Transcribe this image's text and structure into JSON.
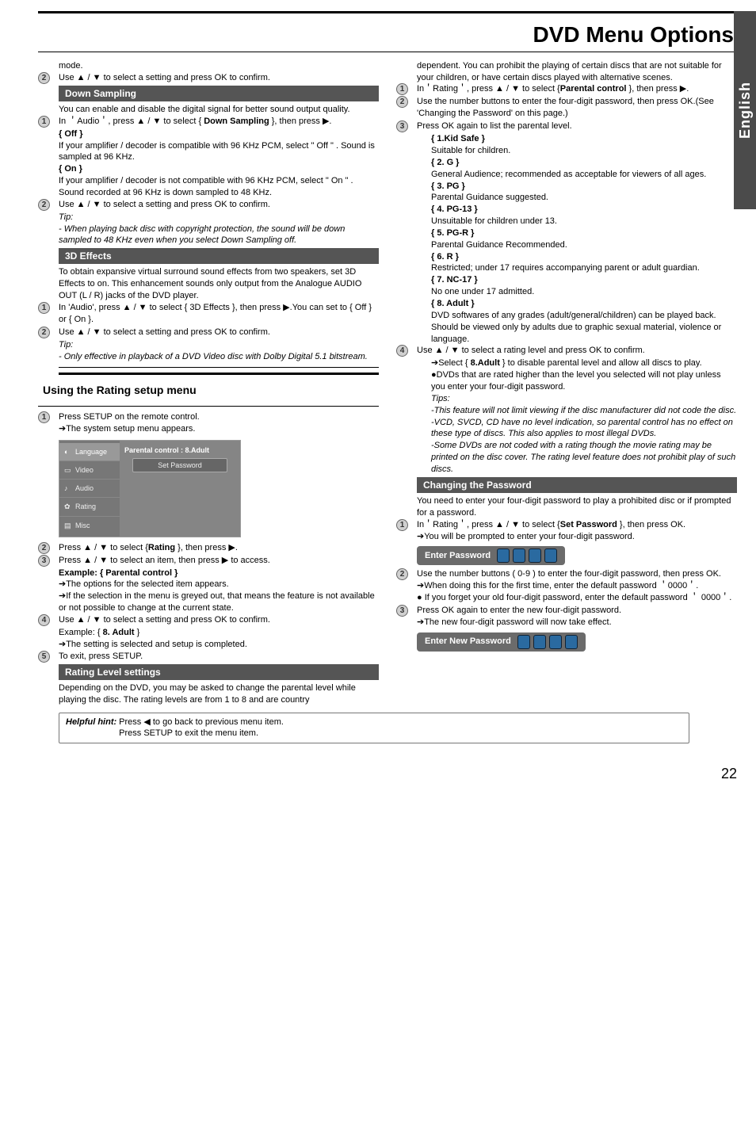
{
  "title": "DVD Menu Options",
  "side_tab": "English",
  "page_number": "22",
  "left": {
    "mode_tail": "mode.",
    "step_mode2": "Use ▲ / ▼ to select a setting and press OK to confirm.",
    "down_sampling": {
      "head": "Down Sampling",
      "intro": "You can enable and disable the digital signal for better sound output quality.",
      "s1": "In ＇Audio＇, press ▲ / ▼ to select { Down Sampling }, then press ▶.",
      "off_label": "{ Off }",
      "off_text": "If your amplifier / decoder is compatible with 96 KHz PCM, select \" Off \" . Sound is sampled at 96 KHz.",
      "on_label": "{ On }",
      "on_text": "If your amplifier / decoder is not compatible with 96 KHz PCM, select \" On \" . Sound recorded at 96 KHz is down sampled to 48 KHz.",
      "s2": "Use ▲ / ▼ to select a setting and press OK to confirm.",
      "tip_label": "Tip:",
      "tip_text": "- When playing back disc with copyright protection, the sound will be down sampled to 48 KHz even when you select Down Sampling off."
    },
    "fx": {
      "head": "3D Effects",
      "intro": "To obtain expansive virtual surround sound effects from two speakers, set 3D Effects to on. This enhancement sounds only output from the Analogue AUDIO OUT (L / R) jacks of the DVD player.",
      "s1": "In 'Audio', press ▲ / ▼ to select { 3D Effects }, then press ▶.You can set to { Off } or { On }.",
      "s2": "Use ▲ / ▼ to select a setting and press OK to confirm.",
      "tip_label": "Tip:",
      "tip_text": "- Only effective in playback of a DVD Video disc with Dolby Digital 5.1 bitstream."
    },
    "rating_setup": {
      "heading": "Using the Rating setup menu",
      "s1a": "Press SETUP on the remote control.",
      "s1b": "➔The system setup menu appears.",
      "menu": {
        "tabs": [
          "Language",
          "Video",
          "Audio",
          "Rating",
          "Misc"
        ],
        "row1": "Parental control      : 8.Adult",
        "btn": "Set Password"
      },
      "s2": "Press ▲ / ▼ to select {Rating }, then press ▶.",
      "s3": "Press ▲ / ▼ to select an item, then press ▶ to access.",
      "ex_label": "Example: { Parental control }",
      "ex_a": "➔The options for the selected item appears.",
      "ex_b": "➔If the selection in the menu is greyed out, that means the feature is not available or not possible to change at the current state.",
      "s4": "Use ▲ / ▼ to select a setting and press OK to confirm.",
      "ex2": "Example: { 8. Adult }",
      "ex2a": "➔The setting is selected and setup is completed.",
      "s5": "To exit, press SETUP.",
      "rls_head": "Rating Level settings",
      "rls_text": "Depending on the DVD, you may be asked to change the parental level while playing the disc. The rating levels are from 1 to 8 and are country"
    }
  },
  "right": {
    "cont": "dependent. You can prohibit the playing of certain discs that are not suitable for your children, or have certain discs played with alternative scenes.",
    "s1": "In＇Rating＇, press ▲ / ▼ to select {Parental control }, then press ▶.",
    "s2": "Use the number buttons to enter the four-digit password, then press OK.(See 'Changing the Password' on this page.)",
    "s3": "Press OK again to list the parental level.",
    "levels": {
      "l1h": "{ 1.Kid Safe }",
      "l1t": "Suitable for children.",
      "l2h": "{ 2. G }",
      "l2t": "General Audience; recommended as acceptable for viewers of all ages.",
      "l3h": "{ 3. PG }",
      "l3t": "Parental Guidance suggested.",
      "l4h": "{ 4. PG-13 }",
      "l4t": "Unsuitable for children under 13.",
      "l5h": "{ 5. PG-R }",
      "l5t": "Parental Guidance Recommended.",
      "l6h": "{ 6. R }",
      "l6t": "Restricted; under 17 requires accompanying parent or adult guardian.",
      "l7h": "{ 7. NC-17 }",
      "l7t": "No one under 17 admitted.",
      "l8h": "{ 8. Adult }",
      "l8t": "DVD softwares of any grades (adult/general/children) can be played back. Should be viewed only by adults due to graphic sexual material, violence or language."
    },
    "s4": "Use ▲ / ▼ to select a rating level and press OK to confirm.",
    "s4a": "➔Select { 8.Adult } to disable parental level and allow all discs to play.",
    "s4b": "●DVDs that are rated higher than the level you selected will not play unless you enter your four-digit password.",
    "tips_label": "Tips:",
    "tips_a": "-This feature will not limit viewing if the disc manufacturer did not code the disc.",
    "tips_b": "-VCD, SVCD, CD have no level indication, so parental control has no effect on these type of discs. This also applies to most illegal DVDs.",
    "tips_c": "-Some DVDs are not coded with a rating though the movie rating may be printed on the disc cover. The rating level feature does not prohibit play of such discs.",
    "cp_head": "Changing the Password",
    "cp_intro": "You need to enter your four-digit password to play a prohibited disc or if prompted for a password.",
    "cp1": "In＇Rating＇, press ▲ / ▼ to select {Set Password }, then press OK.",
    "cp1a": "➔You will be prompted to enter your four-digit password.",
    "pw1_label": "Enter Password",
    "cp2": "Use the number buttons ( 0-9 ) to enter the four-digit password, then press OK.",
    "cp2a": "➔When doing this for the first time, enter the default password ＇0000＇.",
    "cp2b": "● If you forget your old four-digit password, enter the default password ＇ 0000＇.",
    "cp3": "Press OK again to enter the new four-digit password.",
    "cp3a": "➔The new four-digit password will now take effect.",
    "pw2_label": "Enter New Password"
  },
  "hint": {
    "label": "Helpful hint:",
    "l1": "Press ◀ to go back to previous menu item.",
    "l2": "Press SETUP to exit the menu item."
  }
}
